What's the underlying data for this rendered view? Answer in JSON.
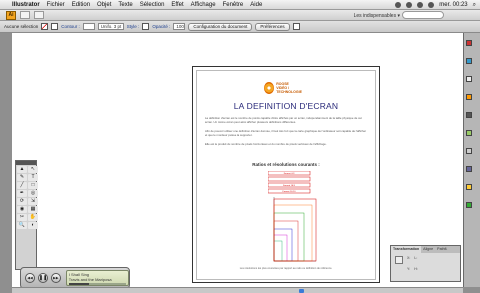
{
  "menubar": {
    "apple": "",
    "app_name": "Illustrator",
    "items": [
      "Fichier",
      "Edition",
      "Objet",
      "Texte",
      "Sélection",
      "Effet",
      "Affichage",
      "Fenêtre",
      "Aide"
    ],
    "clock": "mer. 00:23"
  },
  "appbar": {
    "logo": "Ai",
    "workspace": "Les indispensables ▾"
  },
  "controlbar": {
    "selection_label": "Aucune sélection",
    "stroke_label": "Contour :",
    "stroke_field": "",
    "brush_field": "Unifo. 3 pt",
    "style_label": "Style :",
    "opacity_label": "Opacité :",
    "opacity_value": "100",
    "doc_setup_button": "Configuration du document",
    "prefs_button": "Préférences"
  },
  "document": {
    "logo_line1": "ROOSE",
    "logo_line2": "VIDÉO / TECHNOLOGIE",
    "title": "LA DEFINITION D'ECRAN",
    "para1": "La définition d'écran est le nombre de points capable d'être affichés par un écran, indépendamment de la taille physique de cet écran. Un même écran peut ainsi afficher plusieurs définitions différentes.",
    "para2": "Afin de pouvoir utiliser une définition d'écran donnée, il faut très fort que la carte graphique de l'ordinateur soit capable de l'afficher et que le moniteur puisse la supporter.",
    "para3": "Elle est le produit du nombre de pixels horizontaux et du nombre de pixels verticaux de l'affichage.",
    "chart_heading": "Ratios et résolutions courants :",
    "chart_rows": [
      "Format 4:3",
      "",
      "Format 16:9",
      "Format 16:10"
    ],
    "caption": "Les résolutions les plus courantes par rapport au ratio ou définition de référence."
  },
  "tools_glyphs": [
    "▲",
    "↖",
    "✎",
    "T",
    "╱",
    "□",
    "✒",
    "◎",
    "⟳",
    "⇲",
    "◉",
    "▦",
    "✂",
    "✋",
    "🔍",
    "◐"
  ],
  "transform_panel": {
    "tabs": [
      "Transformation",
      "Aligne",
      "Pathfi."
    ],
    "x_label": "X:",
    "y_label": "Y:",
    "w_label": "L:",
    "h_label": "H:"
  },
  "itunes": {
    "prev": "◀◀",
    "play": "❚❚",
    "next": "▶▶",
    "line1": "I Shall Sing",
    "line2": "Travis and the Mariposa",
    "progress": 0.35
  },
  "colors": {
    "accent_orange": "#f5a623",
    "title_blue": "#2a2a7a",
    "chart_red": "#d40000"
  }
}
